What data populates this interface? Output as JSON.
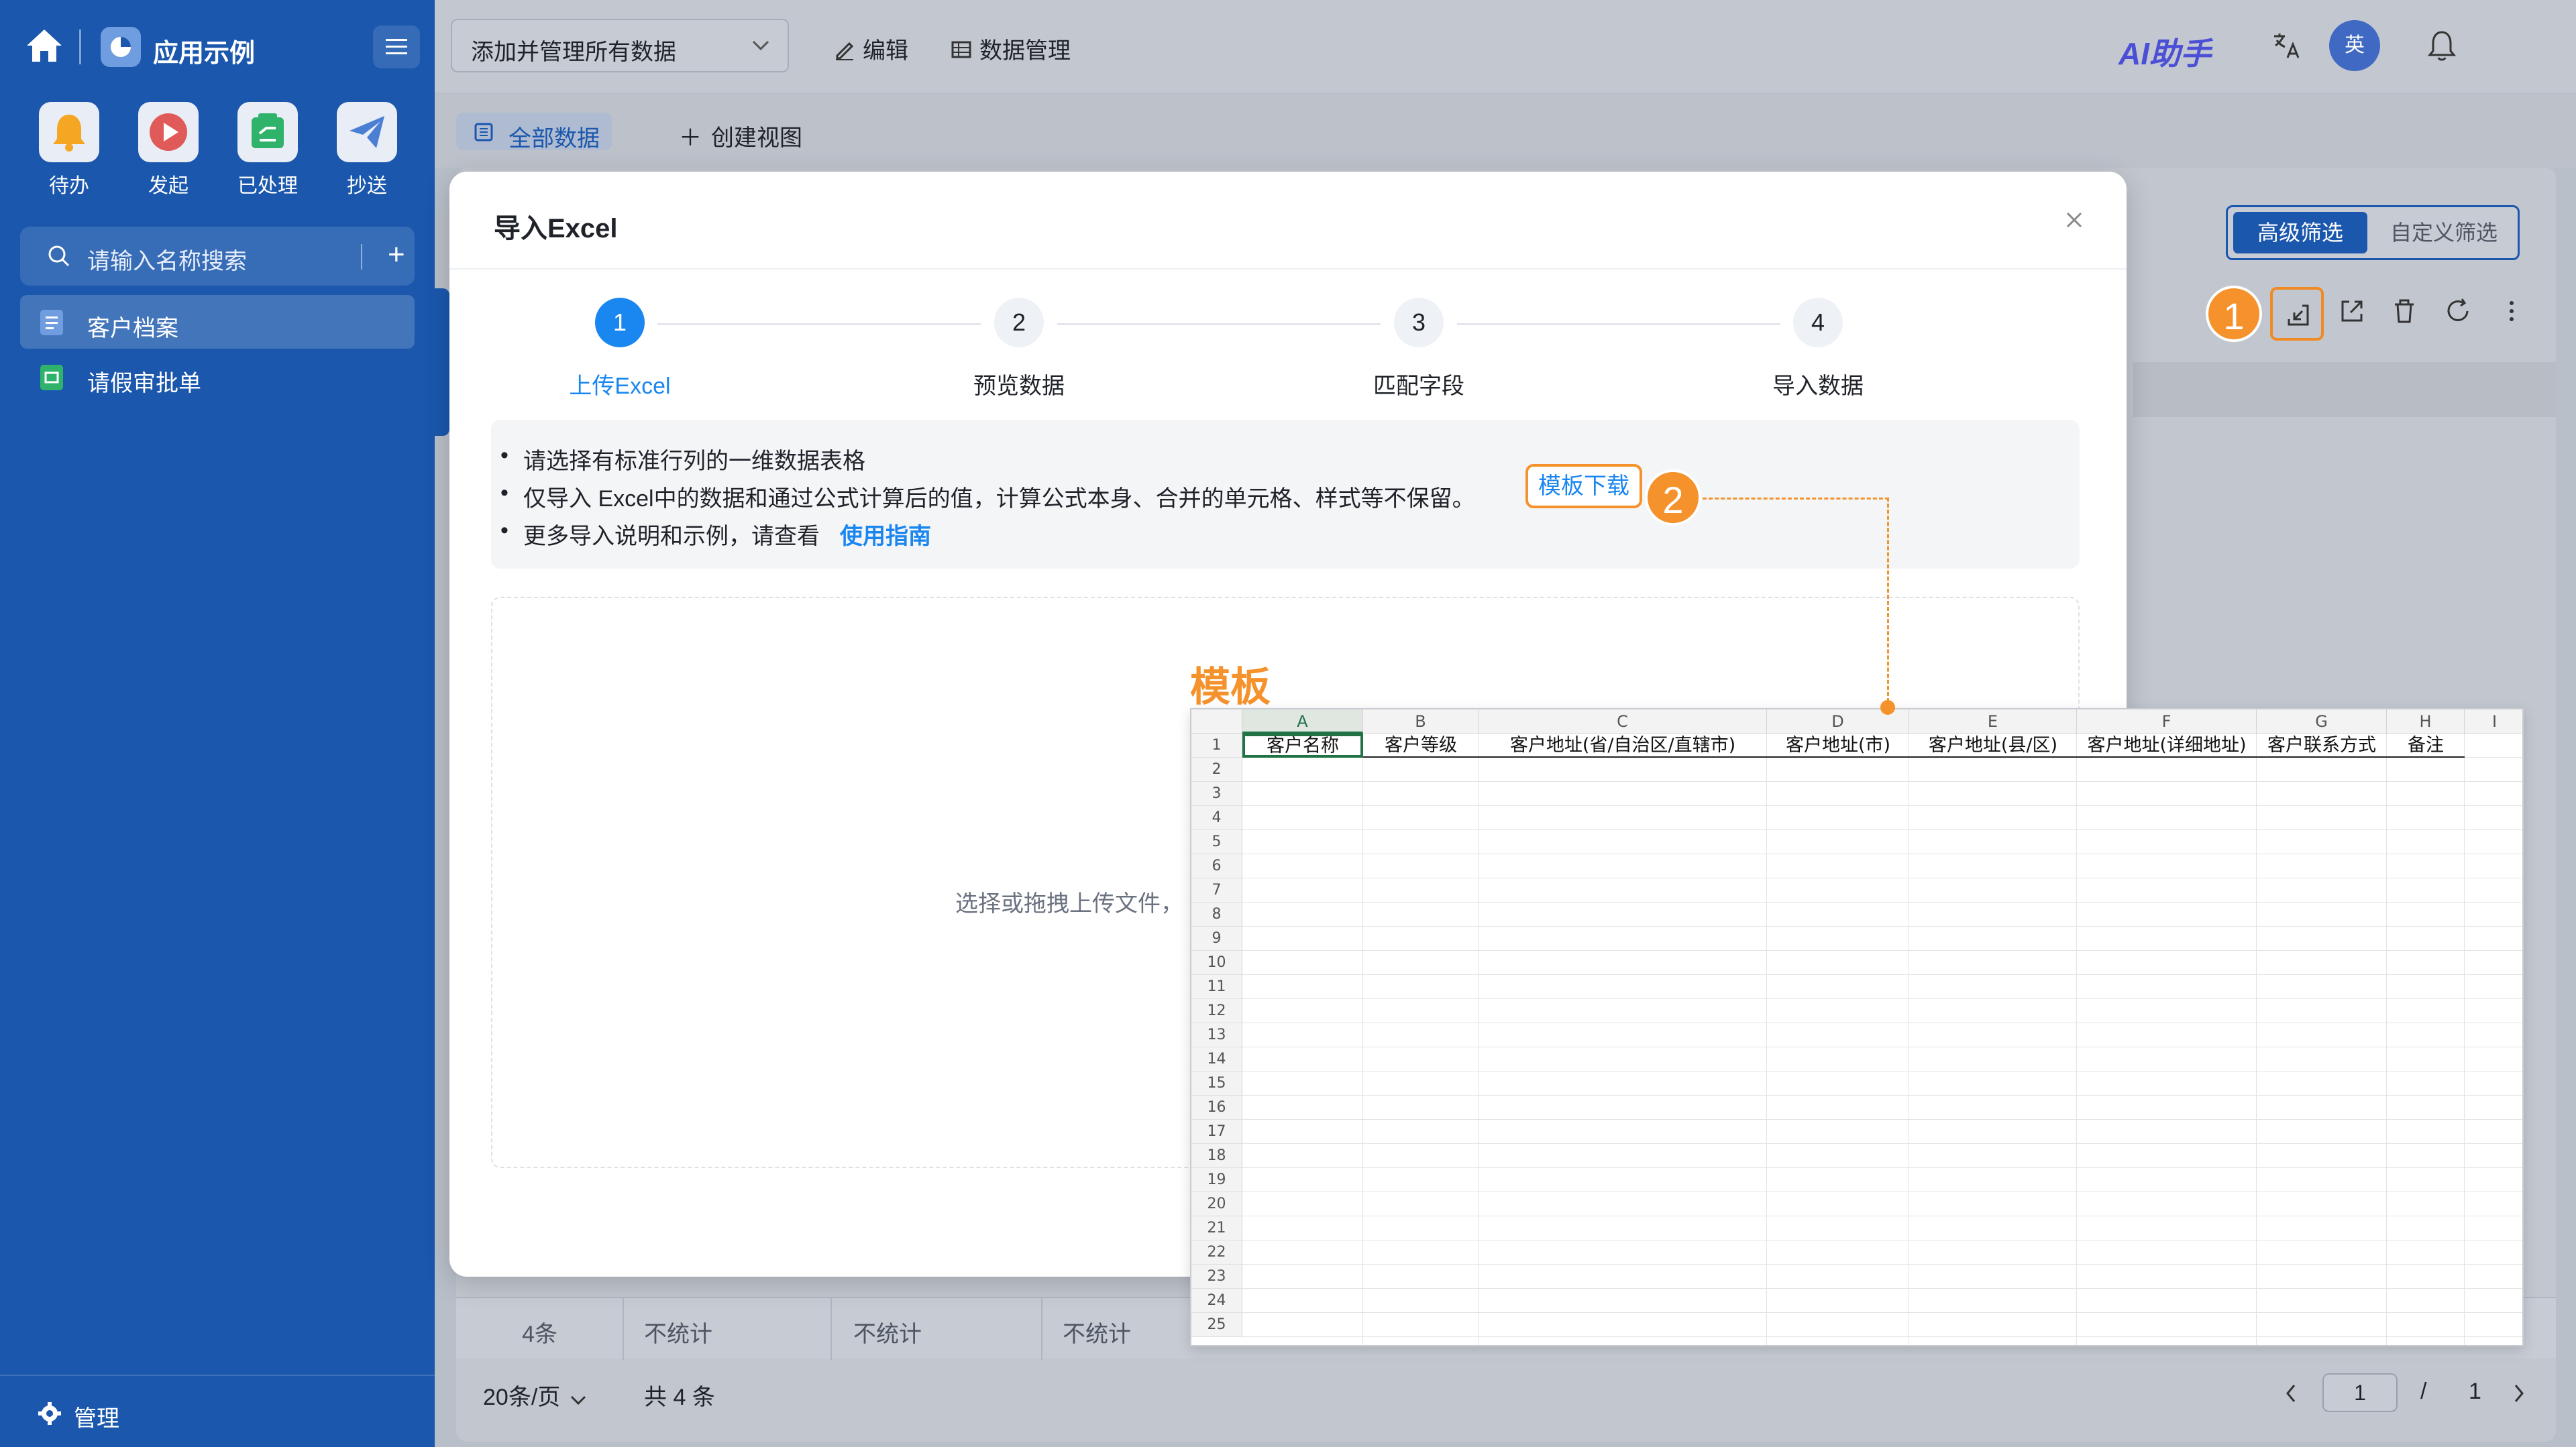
{
  "sidebar": {
    "app_title": "应用示例",
    "quick_actions": [
      {
        "label": "待办",
        "icon": "bell-icon",
        "color": "#f5a623"
      },
      {
        "label": "发起",
        "icon": "play-icon",
        "color": "#e05a5a"
      },
      {
        "label": "已处理",
        "icon": "check-doc-icon",
        "color": "#2fb36b"
      },
      {
        "label": "抄送",
        "icon": "send-icon",
        "color": "#4a7fd4"
      }
    ],
    "search_placeholder": "请输入名称搜索",
    "items": [
      {
        "label": "客户档案",
        "icon": "doc-icon",
        "color": "#6f9de0"
      },
      {
        "label": "请假审批单",
        "icon": "form-icon",
        "color": "#2fb36b"
      }
    ],
    "footer_label": "管理"
  },
  "topbar": {
    "view_select": "添加并管理所有数据",
    "edit_label": "编辑",
    "data_manage_label": "数据管理",
    "ai_label": "AI助手",
    "avatar_text": "英"
  },
  "subbar": {
    "all_data_tab": "全部数据",
    "create_view": "创建视图"
  },
  "filters": {
    "advanced": "高级筛选",
    "custom": "自定义筛选"
  },
  "callouts": [
    "1",
    "2"
  ],
  "modal": {
    "title": "导入Excel",
    "steps": [
      {
        "num": "1",
        "label": "上传Excel"
      },
      {
        "num": "2",
        "label": "预览数据"
      },
      {
        "num": "3",
        "label": "匹配字段"
      },
      {
        "num": "4",
        "label": "导入数据"
      }
    ],
    "info": {
      "line1": "请选择有标准行列的一维数据表格",
      "line2": "仅导入 Excel中的数据和通过公式计算后的值，计算公式本身、合并的单元格、样式等不保留。",
      "template_download": "模板下载",
      "line3": "更多导入说明和示例，请查看",
      "guide_link": "使用指南"
    },
    "dropzone_text": "选择或拖拽上传文件，"
  },
  "template": {
    "title": "模板",
    "columns": [
      "A",
      "B",
      "C",
      "D",
      "E",
      "F",
      "G",
      "H",
      "I"
    ],
    "headers": [
      "客户名称",
      "客户等级",
      "客户地址(省/自治区/直辖市)",
      "客户地址(市)",
      "客户地址(县/区)",
      "客户地址(详细地址)",
      "客户联系方式",
      "备注"
    ],
    "row_numbers": [
      "1",
      "2",
      "3",
      "4",
      "5",
      "6",
      "7",
      "8",
      "9",
      "10",
      "11",
      "12",
      "13",
      "14",
      "15",
      "16",
      "17",
      "18",
      "19",
      "20",
      "21",
      "22",
      "23",
      "24",
      "25"
    ]
  },
  "table_footer": {
    "count": "4条",
    "stat_labels": [
      "不统计",
      "不统计",
      "不统计"
    ]
  },
  "pagination": {
    "page_size": "20条/页",
    "total": "共 4 条",
    "current_page": "1",
    "slash": "/",
    "page_count": "1"
  }
}
